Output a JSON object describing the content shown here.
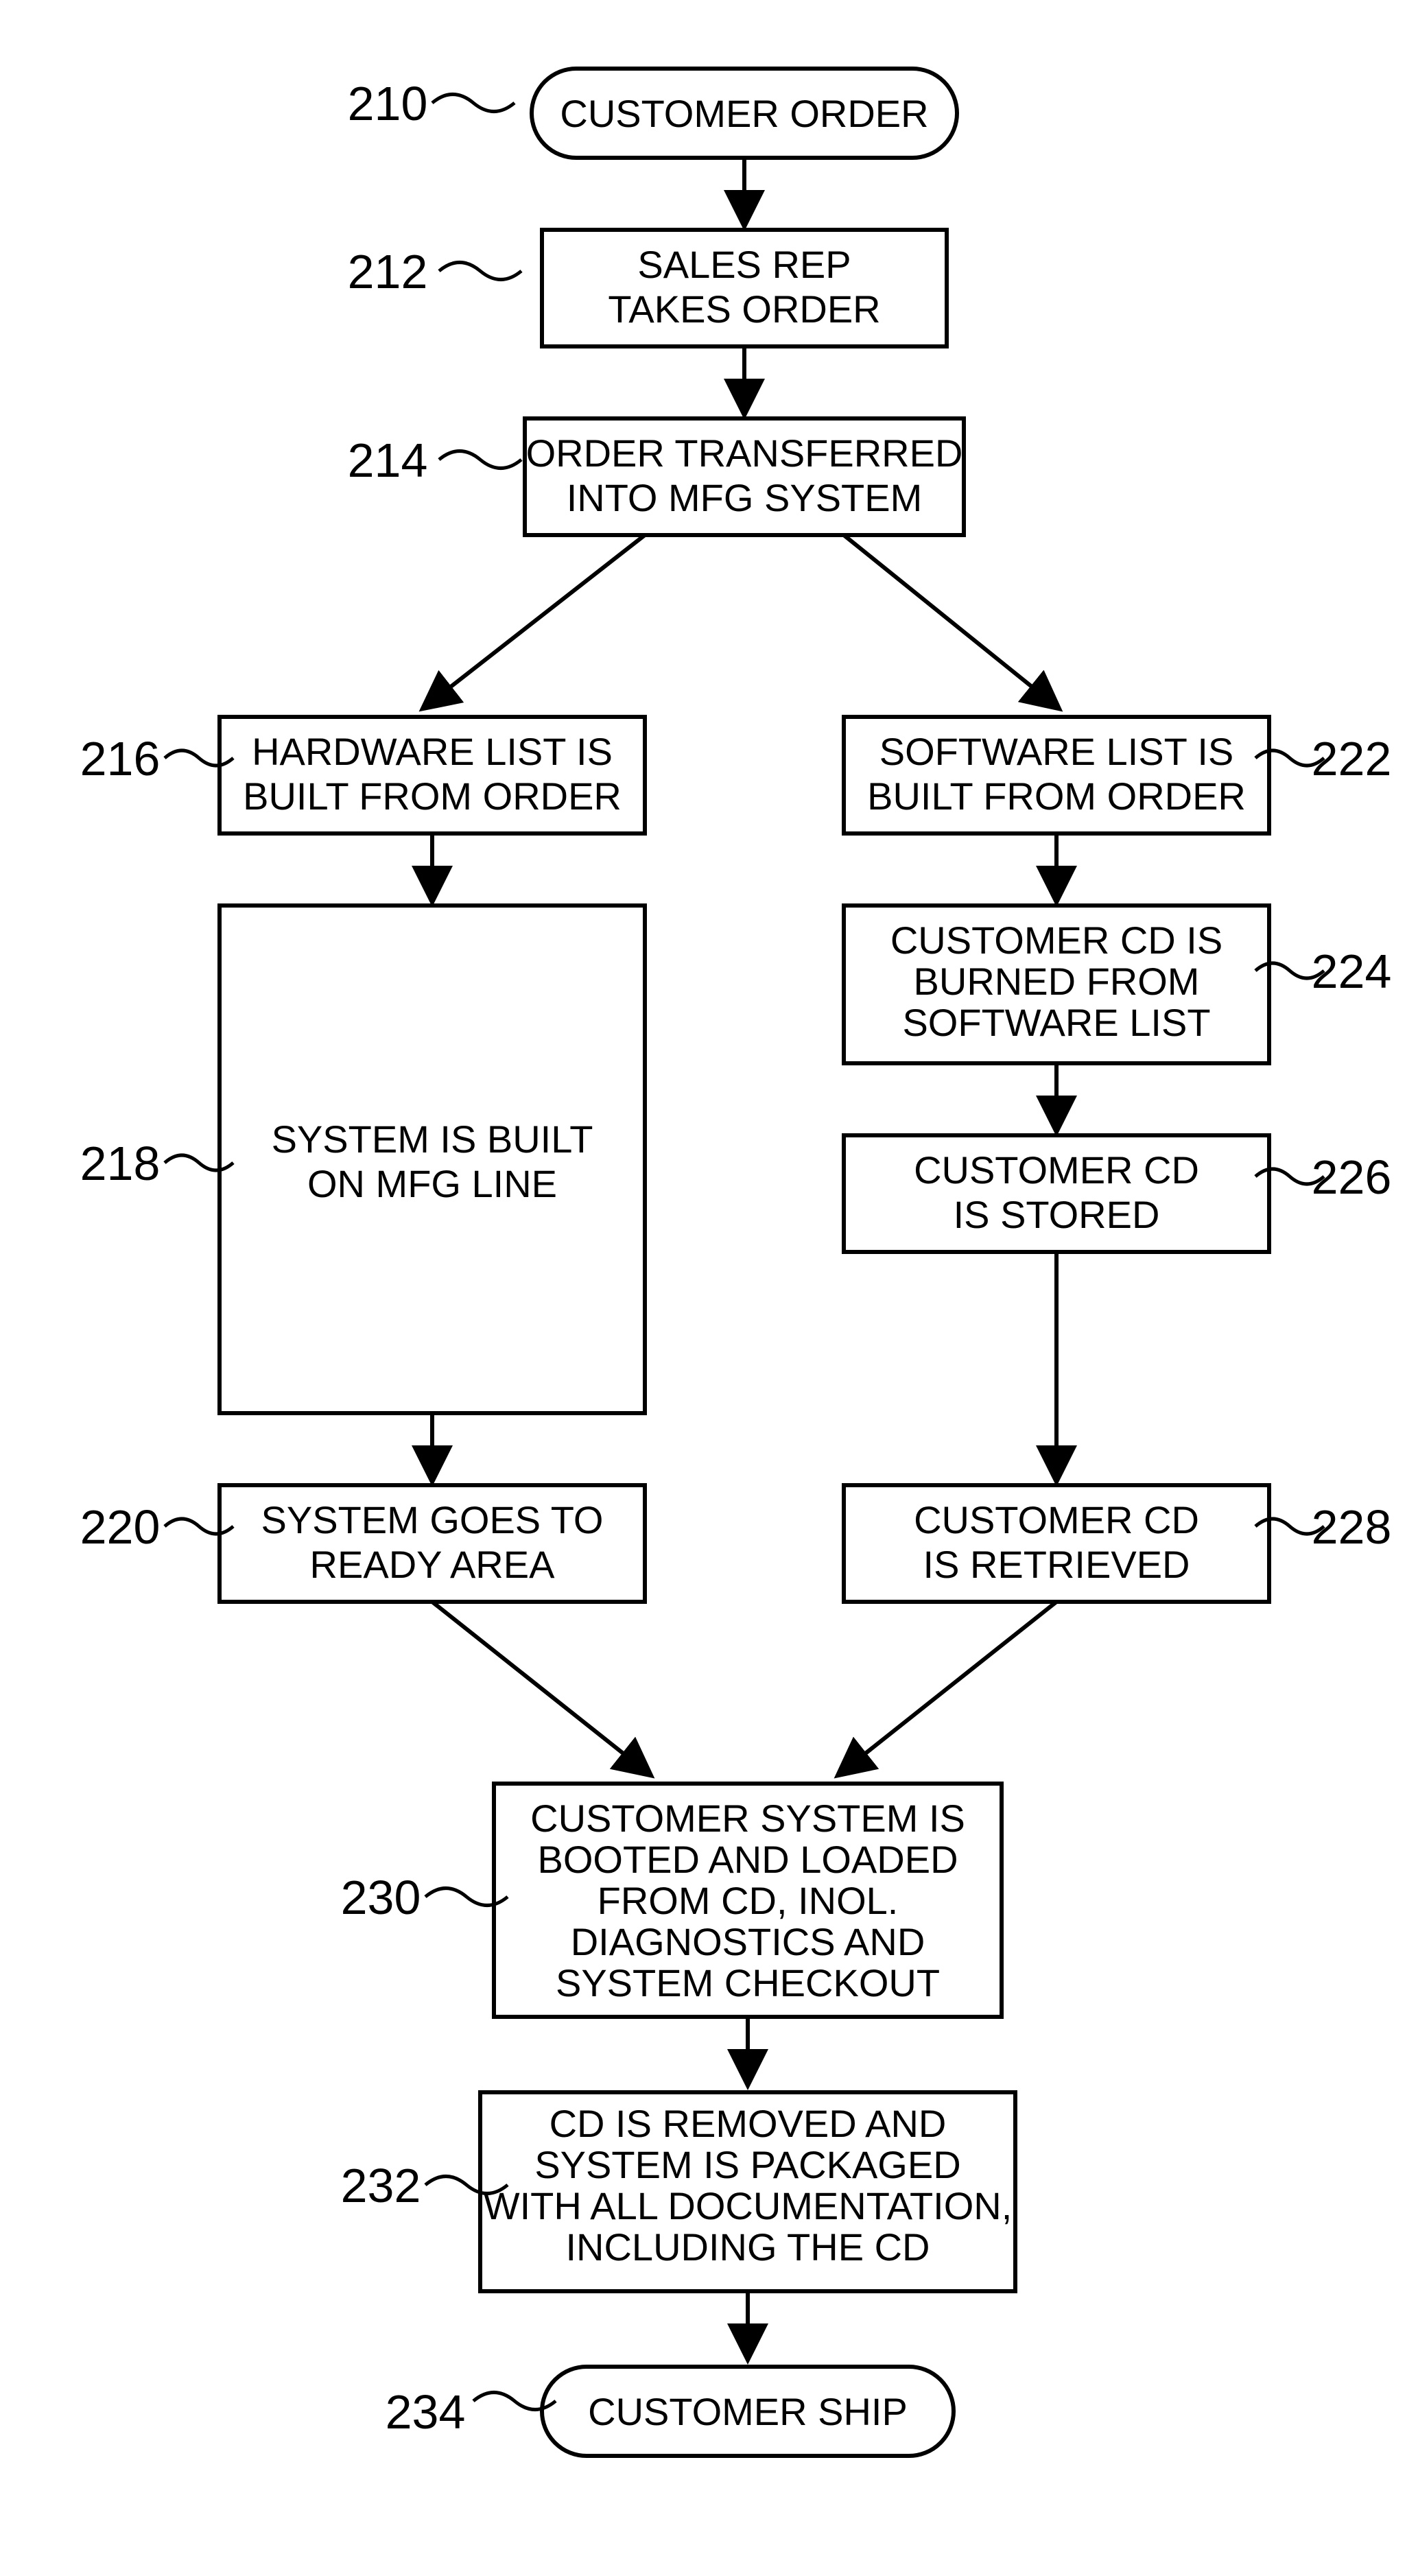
{
  "nodes": {
    "n210": {
      "ref": "210",
      "lines": [
        "CUSTOMER ORDER"
      ]
    },
    "n212": {
      "ref": "212",
      "lines": [
        "SALES REP",
        "TAKES ORDER"
      ]
    },
    "n214": {
      "ref": "214",
      "lines": [
        "ORDER TRANSFERRED",
        "INTO MFG SYSTEM"
      ]
    },
    "n216": {
      "ref": "216",
      "lines": [
        "HARDWARE LIST IS",
        "BUILT FROM ORDER"
      ]
    },
    "n218": {
      "ref": "218",
      "lines": [
        "SYSTEM IS BUILT",
        "ON MFG LINE"
      ]
    },
    "n220": {
      "ref": "220",
      "lines": [
        "SYSTEM GOES TO",
        "READY AREA"
      ]
    },
    "n222": {
      "ref": "222",
      "lines": [
        "SOFTWARE LIST IS",
        "BUILT FROM ORDER"
      ]
    },
    "n224": {
      "ref": "224",
      "lines": [
        "CUSTOMER CD IS",
        "BURNED FROM",
        "SOFTWARE LIST"
      ]
    },
    "n226": {
      "ref": "226",
      "lines": [
        "CUSTOMER CD",
        "IS STORED"
      ]
    },
    "n228": {
      "ref": "228",
      "lines": [
        "CUSTOMER CD",
        "IS RETRIEVED"
      ]
    },
    "n230": {
      "ref": "230",
      "lines": [
        "CUSTOMER SYSTEM IS",
        "BOOTED AND LOADED",
        "FROM CD, INOL.",
        "DIAGNOSTICS AND",
        "SYSTEM CHECKOUT"
      ]
    },
    "n232": {
      "ref": "232",
      "lines": [
        "CD IS REMOVED AND",
        "SYSTEM IS PACKAGED",
        "WITH ALL DOCUMENTATION,",
        "INCLUDING THE CD"
      ]
    },
    "n234": {
      "ref": "234",
      "lines": [
        "CUSTOMER SHIP"
      ]
    }
  }
}
